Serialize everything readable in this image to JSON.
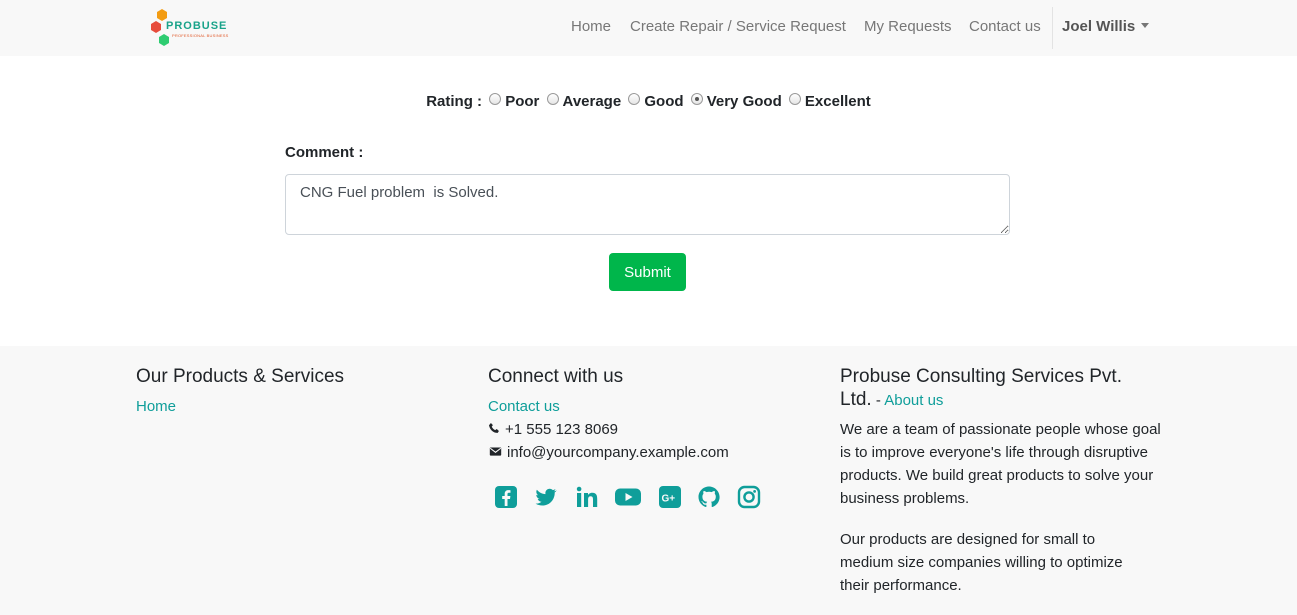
{
  "navbar": {
    "logo_text": "PROBUSE",
    "logo_sub": "PROFESSIONAL BUSINESS",
    "links": [
      "Home",
      "Create Repair / Service Request",
      "My Requests",
      "Contact us"
    ],
    "user": "Joel Willis"
  },
  "rating": {
    "label": "Rating :",
    "options": [
      "Poor",
      "Average",
      "Good",
      "Very Good",
      "Excellent"
    ],
    "selected": "Very Good"
  },
  "comment": {
    "label": "Comment :",
    "value": "CNG Fuel problem  is Solved."
  },
  "submit_label": "Submit",
  "footer": {
    "products": {
      "heading": "Our Products & Services",
      "links": [
        "Home"
      ]
    },
    "connect": {
      "heading": "Connect with us",
      "contact_link": "Contact us",
      "phone": "+1 555 123 8069",
      "email": "info@yourcompany.example.com",
      "social_icons": [
        "facebook-icon",
        "twitter-icon",
        "linkedin-icon",
        "youtube-icon",
        "google-plus-icon",
        "github-icon",
        "instagram-icon"
      ]
    },
    "company": {
      "heading_line1": "Probuse Consulting Services Pvt.",
      "heading_line2": "Ltd.",
      "separator": " - ",
      "about_link": "About us",
      "para1": "We are a team of passionate people whose goal is to improve everyone's life through disruptive products. We build great products to solve your business problems.",
      "para2": "Our products are designed for small to medium size companies willing to optimize their performance."
    }
  },
  "colors": {
    "accent": "#0f9e9a",
    "submit": "#00b64b",
    "navbar_bg": "#f8f8f8"
  }
}
